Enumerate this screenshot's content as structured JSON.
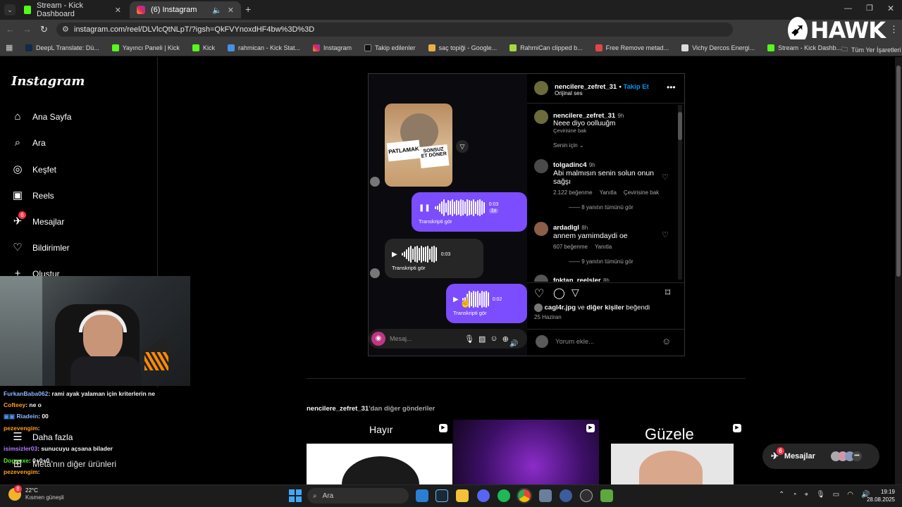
{
  "tabs": [
    {
      "label": "Stream - Kick Dashboard"
    },
    {
      "label": "(6) Instagram"
    }
  ],
  "url": "instagram.com/reel/DLVlcQtNLpT/?igsh=QkFVYnoxdHF4bw%3D%3D",
  "bookmarks": [
    "DeepL Translate: Dü...",
    "Yayıncı Paneli | Kick",
    "Kick",
    "rahmican - Kick Stat...",
    "Instagram",
    "Takip edilenler",
    "saç topiği - Google...",
    "RahmiCan clipped b...",
    "Free Remove metad...",
    "Vichy Dercos Energi...",
    "Stream - Kick Dashb..."
  ],
  "bookmarks_all": "Tüm Yer İşaretleri",
  "hawk": "HAWK",
  "ig_logo": "Instagram",
  "nav": [
    {
      "label": "Ana Sayfa",
      "icon": "home-icon"
    },
    {
      "label": "Ara",
      "icon": "search-icon"
    },
    {
      "label": "Keşfet",
      "icon": "explore-icon"
    },
    {
      "label": "Reels",
      "icon": "reels-icon"
    },
    {
      "label": "Mesajlar",
      "icon": "messenger-icon",
      "badge": "6"
    },
    {
      "label": "Bildirimler",
      "icon": "heart-icon"
    },
    {
      "label": "Oluştur",
      "icon": "plus-icon"
    }
  ],
  "nav_more": "Daha fazla",
  "nav_meta": "Meta'nın diğer ürünleri",
  "chat": [
    {
      "user": "FurkanBaba062",
      "text": ": rami ayak yalaman için kriterlerin ne",
      "color": "#8fb8ff"
    },
    {
      "user": "Cofteey",
      "text": ": ne o",
      "color": "#ff9f1a"
    },
    {
      "user": "Riadein",
      "text": ": 00",
      "color": "#8fb8ff"
    },
    {
      "user": "pezevengim",
      "text": ":",
      "color": "#ff9f1a"
    },
    {
      "user": "isimsizler03",
      "text": ": sunucuyu açsana bilader",
      "color": "#b47cff"
    },
    {
      "user": "Doguexe",
      "text": ": 0+0+0",
      "color": "#53fc18"
    },
    {
      "user": "pezevengim",
      "text": ":",
      "color": "#ff9f1a"
    }
  ],
  "reel": {
    "sign_left": "PATLAMAK",
    "sign_right": "SONSUZ ET DÖNER",
    "voice1_time": "0:03",
    "voice1_speed": "1x",
    "voice1_transcript": "Transkripti gör",
    "voice2_time": "0:03",
    "voice2_transcript": "Transkripti gör",
    "voice3_time": "0:02",
    "voice3_transcript": "Transkripti gör",
    "message_placeholder": "Mesaj..."
  },
  "post": {
    "author": "nencilere_zefret_31",
    "follow": "Takip Et",
    "audio": "Orijinal ses",
    "caption_user": "nencilere_zefret_31",
    "caption_time": "9h",
    "caption": "Neee diyo oolluuğm",
    "caption_translate": "Çevirisine bak",
    "sort": "Senin için",
    "comments": [
      {
        "user": "tolgadinc4",
        "time": "9h",
        "text": "Abi malmısın senin solun onun sağşı",
        "likes": "2.122 beğenme",
        "reply": "Yanıtla",
        "translate": "Çevirisine bak",
        "replies": "8 yanıtın tümünü gör"
      },
      {
        "user": "ardadlgl",
        "time": "8h",
        "text": "annem yamimdaydi oe",
        "likes": "607 beğenme",
        "reply": "Yanıtla",
        "translate": "",
        "replies": "9 yanıtın tümünü gör"
      },
      {
        "user": "foktan_reelsler",
        "time": "8h",
        "text": "",
        "likes": "",
        "reply": "",
        "translate": "",
        "replies": ""
      }
    ],
    "liked_by_user": "cagl4r.jpg",
    "liked_by_mid": "ve",
    "liked_by_others": "diğer kişiler",
    "liked_by_end": "beğendi",
    "date": "25 Haziran",
    "comment_placeholder": "Yorum ekle..."
  },
  "more_posts_user": "nencilere_zefret_31",
  "more_posts_suffix": "'dan diğer gönderiler",
  "thumbs": [
    {
      "caption": "Hayır"
    },
    {
      "caption": ""
    },
    {
      "caption": "Güzele"
    }
  ],
  "messages_button": "Mesajlar",
  "messages_badge": "6",
  "taskbar": {
    "weather_temp": "22°C",
    "weather_desc": "Kısmen güneşli",
    "weather_badge": "8",
    "search": "Ara",
    "time": "19:19",
    "date": "28.08.2025"
  }
}
